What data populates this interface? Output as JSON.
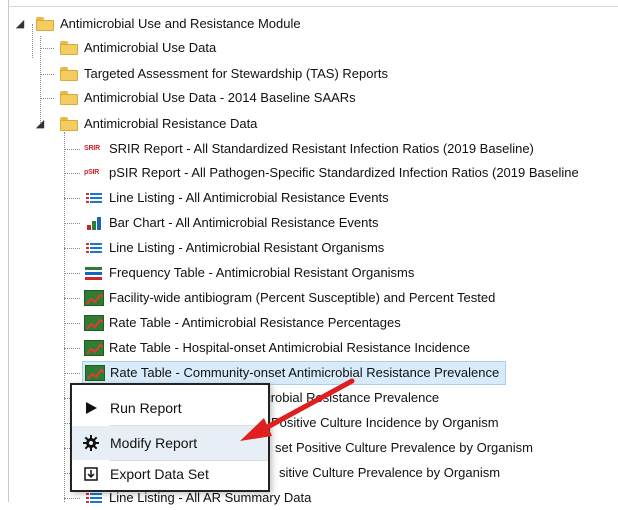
{
  "tree": {
    "root_label": "Antimicrobial Use and Resistance Module",
    "folders": [
      {
        "label": "Antimicrobial Use Data"
      },
      {
        "label": "Targeted Assessment for Stewardship (TAS) Reports"
      },
      {
        "label": "Antimicrobial Use Data - 2014 Baseline SAARs"
      },
      {
        "label": "Antimicrobial Resistance Data"
      }
    ],
    "reports": [
      {
        "icon": "srir-icon",
        "icon_text": "SRIR",
        "label": "SRIR Report - All Standardized Resistant Infection Ratios (2019 Baseline)"
      },
      {
        "icon": "psir-icon",
        "icon_text": "pSIR",
        "label": "pSIR Report - All Pathogen-Specific Standardized Infection Ratios (2019 Baseline"
      },
      {
        "icon": "line-listing-icon",
        "label": "Line Listing - All Antimicrobial Resistance Events"
      },
      {
        "icon": "bar-chart-icon",
        "label": "Bar Chart - All Antimicrobial Resistance Events"
      },
      {
        "icon": "line-listing-icon",
        "label": "Line Listing - Antimicrobial Resistant Organisms"
      },
      {
        "icon": "frequency-table-icon",
        "label": "Frequency Table - Antimicrobial Resistant Organisms"
      },
      {
        "icon": "rate-table-icon",
        "label": "Facility-wide antibiogram (Percent Susceptible) and Percent Tested"
      },
      {
        "icon": "rate-table-icon",
        "label": "Rate Table - Antimicrobial Resistance Percentages"
      },
      {
        "icon": "rate-table-icon",
        "label": "Rate Table - Hospital-onset Antimicrobial Resistance Incidence"
      },
      {
        "icon": "rate-table-icon",
        "label": "Rate Table - Community-onset Antimicrobial Resistance Prevalence",
        "selected": true
      },
      {
        "icon": "rate-table-icon",
        "label": "timicrobial Resistance Prevalence"
      },
      {
        "icon": "rate-table-icon",
        "label": "Positive Culture Incidence by Organism"
      },
      {
        "icon": "rate-table-icon",
        "label": "set Positive Culture Prevalence by Organism"
      },
      {
        "icon": "rate-table-icon",
        "label": "sitive Culture Prevalence by Organism"
      },
      {
        "icon": "line-listing-icon",
        "label": "Line Listing - All AR Summary Data"
      }
    ]
  },
  "context_menu": {
    "items": [
      {
        "icon": "play-icon",
        "label": "Run Report"
      },
      {
        "icon": "gear-icon",
        "label": "Modify Report"
      },
      {
        "icon": "export-icon",
        "label": "Export Data Set"
      }
    ]
  },
  "colors": {
    "selection": "#d7ebfa",
    "annotation_arrow": "#e02020",
    "folder": "#f4cc62"
  }
}
